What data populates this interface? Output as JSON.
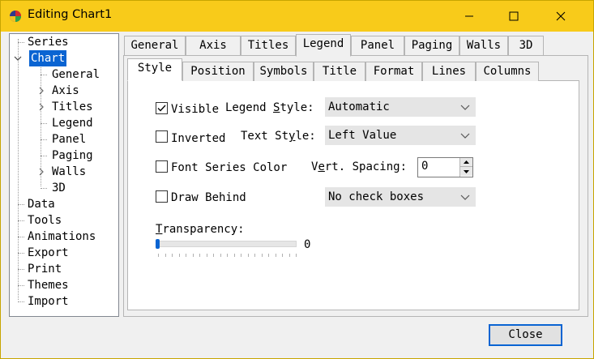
{
  "window": {
    "title": "Editing Chart1",
    "controls": [
      "minimize-icon",
      "maximize-icon",
      "close-icon"
    ]
  },
  "tree": {
    "items": [
      {
        "label": "Series"
      },
      {
        "label": "Chart",
        "selected": true,
        "expanded": true
      },
      {
        "label": "General"
      },
      {
        "label": "Axis",
        "collapsed": true
      },
      {
        "label": "Titles",
        "collapsed": true
      },
      {
        "label": "Legend"
      },
      {
        "label": "Panel"
      },
      {
        "label": "Paging"
      },
      {
        "label": "Walls",
        "collapsed": true
      },
      {
        "label": "3D"
      },
      {
        "label": "Data"
      },
      {
        "label": "Tools"
      },
      {
        "label": "Animations"
      },
      {
        "label": "Export"
      },
      {
        "label": "Print"
      },
      {
        "label": "Themes"
      },
      {
        "label": "Import"
      }
    ]
  },
  "tabs": {
    "outer": [
      "General",
      "Axis",
      "Titles",
      "Legend",
      "Panel",
      "Paging",
      "Walls",
      "3D"
    ],
    "outer_active": "Legend",
    "inner": [
      "Style",
      "Position",
      "Symbols",
      "Title",
      "Format",
      "Lines",
      "Columns"
    ],
    "inner_active": "Style"
  },
  "style_tab": {
    "visible": {
      "label": "Visible",
      "checked": true
    },
    "inverted": {
      "label": "Inverted",
      "checked": false
    },
    "font_series_color": {
      "label": "Font Series Color",
      "checked": false
    },
    "draw_behind": {
      "label": "Draw Behind",
      "checked": false
    },
    "legend_style": {
      "label": "Legend Style:",
      "value": "Automatic"
    },
    "text_style": {
      "label": "Text Style:",
      "value": "Left Value"
    },
    "vert_spacing": {
      "label": "Vert. Spacing:",
      "value": "0"
    },
    "check_boxes": {
      "value": "No check boxes"
    },
    "transparency": {
      "label": "Transparency:",
      "value": "0",
      "level": 0
    }
  },
  "buttons": {
    "close": "Close"
  },
  "colors": {
    "titlebar": "#f8cb1a",
    "accent": "#0a64d2"
  }
}
